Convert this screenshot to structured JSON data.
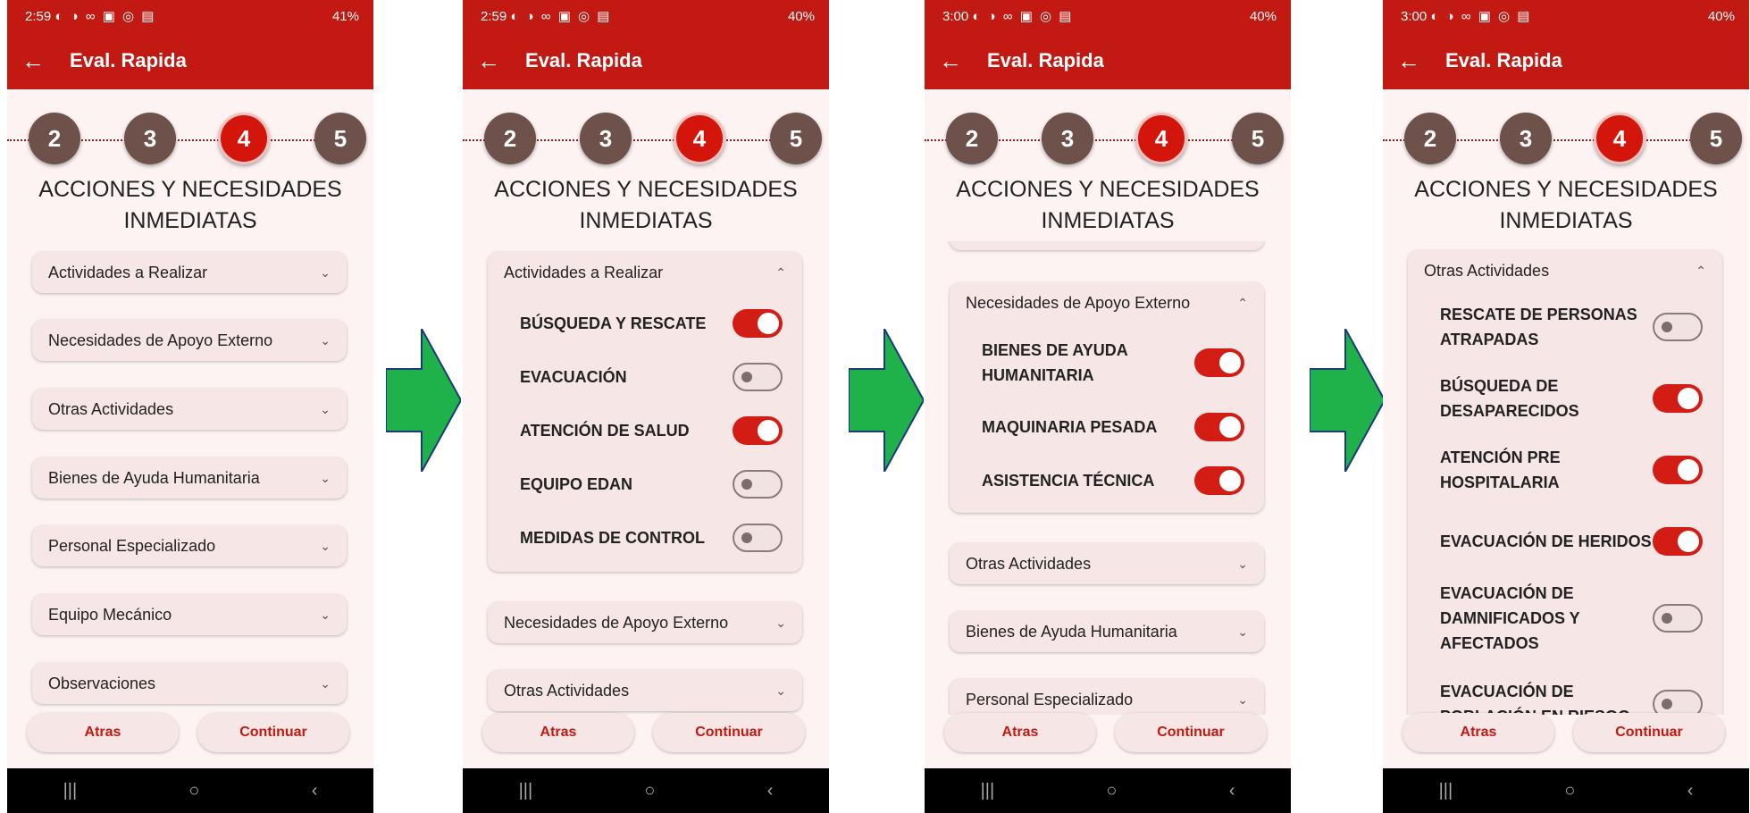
{
  "common": {
    "title": "Eval. Rapida",
    "back_icon": "←",
    "heading_line1": "ACCIONES Y NECESIDADES",
    "heading_line2": "INMEDIATAS",
    "steps": [
      "2",
      "3",
      "4",
      "5"
    ],
    "active_step": "4",
    "btn_back": "Atras",
    "btn_continue": "Continuar",
    "nav_recent": "|||",
    "nav_home": "○",
    "nav_back": "‹",
    "chev_down": "⌄",
    "chev_up": "⌃",
    "accent_color": "#c21a12"
  },
  "screens": [
    {
      "time": "2:59",
      "status_icons": "◐ ◑ ∞ ▣ ◎ ▤",
      "battery": "41%",
      "accordions": [
        "Actividades a Realizar",
        "Necesidades de Apoyo Externo",
        "Otras Actividades",
        "Bienes de Ayuda Humanitaria",
        "Personal Especializado",
        "Equipo Mecánico",
        "Observaciones"
      ]
    },
    {
      "time": "2:59",
      "status_icons": "◐ ◑ ∞ ▣ ◎ ▤",
      "battery": "40%",
      "open_section": "Actividades a Realizar",
      "options": [
        {
          "label": "BÚSQUEDA Y RESCATE",
          "on": true
        },
        {
          "label": "EVACUACIÓN",
          "on": false
        },
        {
          "label": "ATENCIÓN DE SALUD",
          "on": true
        },
        {
          "label": "EQUIPO EDAN",
          "on": false
        },
        {
          "label": "MEDIDAS DE CONTROL",
          "on": false
        }
      ],
      "accordions": [
        "Necesidades de Apoyo Externo",
        "Otras Actividades"
      ]
    },
    {
      "time": "3:00",
      "status_icons": "◐ ◑ ∞ ▣ ◎ ▤",
      "battery": "40%",
      "open_section": "Necesidades de Apoyo Externo",
      "options": [
        {
          "label_line1": "BIENES DE AYUDA",
          "label_line2": "HUMANITARIA",
          "on": true
        },
        {
          "label": "MAQUINARIA PESADA",
          "on": true
        },
        {
          "label": "ASISTENCIA TÉCNICA",
          "on": true
        }
      ],
      "accordions": [
        "Otras Actividades",
        "Bienes de Ayuda Humanitaria",
        "Personal Especializado"
      ]
    },
    {
      "time": "3:00",
      "status_icons": "◐ ◑ ∞ ▣ ◎ ▤",
      "battery": "40%",
      "open_section": "Otras Actividades",
      "options": [
        {
          "label_line1": "RESCATE DE PERSONAS",
          "label_line2": "ATRAPADAS",
          "on": false
        },
        {
          "label_line1": "BÚSQUEDA DE",
          "label_line2": "DESAPARECIDOS",
          "on": true
        },
        {
          "label_line1": "ATENCIÓN PRE",
          "label_line2": "HOSPITALARIA",
          "on": true
        },
        {
          "label": "EVACUACIÓN DE HERIDOS",
          "on": true
        },
        {
          "label_line1": "EVACUACIÓN DE",
          "label_line2": "DAMNIFICADOS Y",
          "label_line3": "AFECTADOS",
          "on": false
        },
        {
          "label_line1": "EVACUACIÓN DE",
          "label_line2": "POBLACIÓN EN RIESGO",
          "on": false
        }
      ]
    }
  ]
}
